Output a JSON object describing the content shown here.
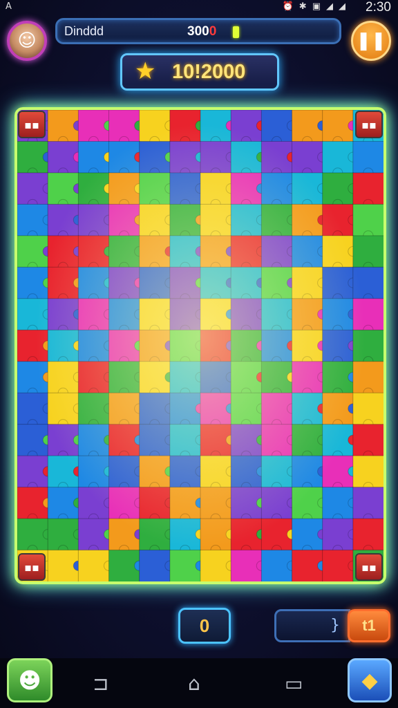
{
  "status_bar": {
    "left_glyph": "A",
    "icons": [
      "alarm-icon",
      "bluetooth-icon",
      "vibrate-icon",
      "signal-icon",
      "signal-icon"
    ],
    "time": "2:30"
  },
  "header": {
    "player_name": "Dinddd",
    "score_main": "300",
    "score_red": "0",
    "target_score": "10!2000"
  },
  "bottom": {
    "counter": "0",
    "progress_cap": "}",
    "action_label": "t1"
  },
  "puzzle_colors": [
    "#e8232e",
    "#f39a1c",
    "#2fae3f",
    "#1e88e5",
    "#7a3fd1",
    "#e82fb8",
    "#19b7d8",
    "#f7d21f",
    "#4fd14a",
    "#2b5fd6"
  ],
  "colors": {
    "board_border": "#c7ff6e",
    "accent_blue": "#4cc3ff",
    "accent_orange": "#ff8b3d"
  }
}
